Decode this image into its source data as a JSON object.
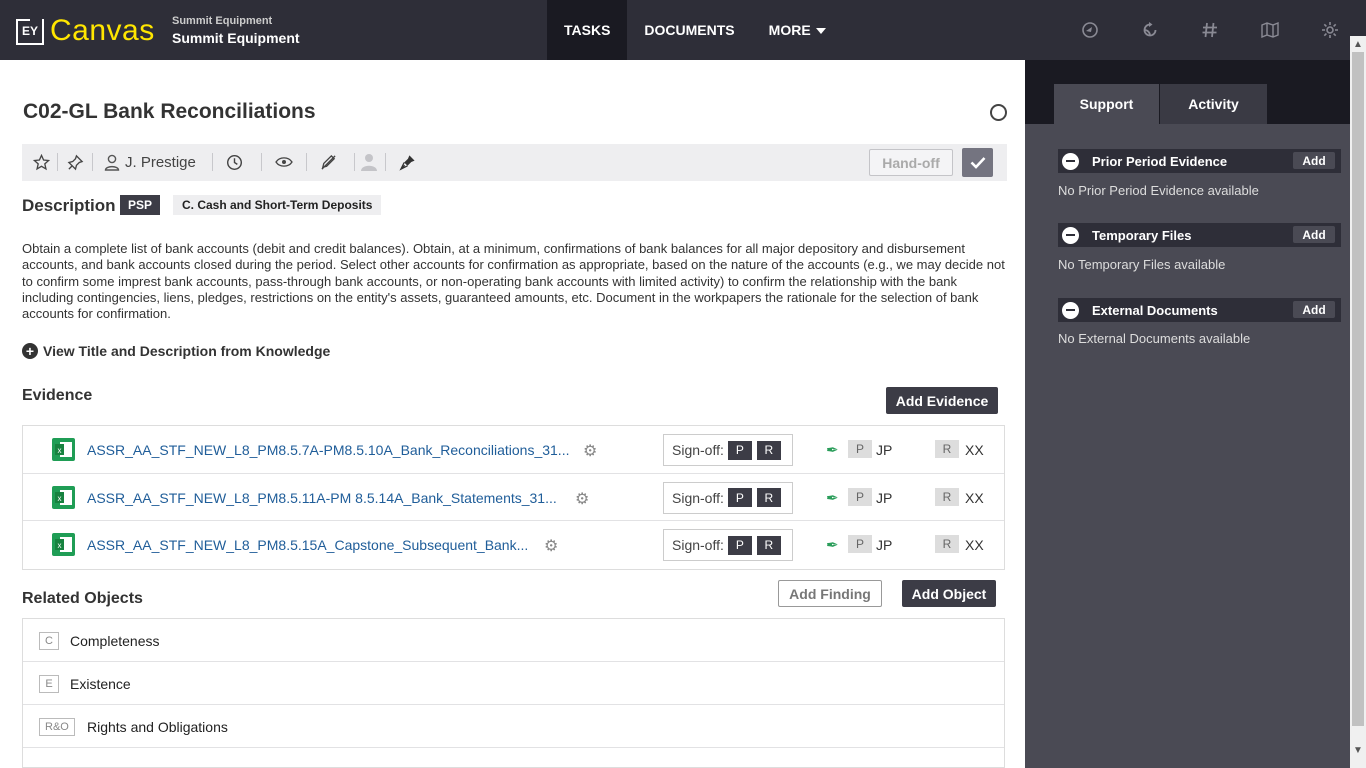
{
  "header": {
    "logo_mark": "EY",
    "app_name": "Canvas",
    "client_small": "Summit Equipment",
    "client_large": "Summit Equipment",
    "nav": [
      {
        "label": "TASKS"
      },
      {
        "label": "DOCUMENTS"
      },
      {
        "label": "MORE"
      }
    ],
    "icons": [
      "dashboard-icon",
      "refresh-icon",
      "hashtag-icon",
      "map-icon",
      "settings-icon"
    ]
  },
  "task": {
    "title": "C02-GL Bank Reconciliations",
    "assignee": "J. Prestige",
    "handoff_label": "Hand-off",
    "description_label": "Description",
    "psp_badge": "PSP",
    "category_badge": "C. Cash and Short-Term Deposits",
    "description": "Obtain a complete list of bank accounts (debit and credit balances). Obtain, at a minimum, confirmations of bank balances for all major depository and disbursement accounts, and bank accounts closed during the period. Select other accounts for confirmation as appropriate, based on the nature of the accounts (e.g., we may decide not to confirm some imprest bank accounts, pass-through bank accounts, or non-operating bank accounts with limited activity) to confirm the relationship with the bank including contingencies, liens, pledges, restrictions on the entity's assets, guaranteed amounts, etc. Document in the workpapers the rationale for the selection of bank accounts for confirmation.",
    "view_knowledge": "View Title and Description from Knowledge"
  },
  "evidence": {
    "title": "Evidence",
    "add_label": "Add Evidence",
    "signoff_label": "Sign-off:",
    "items": [
      {
        "name": "ASSR_AA_STF_NEW_L8_PM8.5.7A-PM8.5.10A_Bank_Reconciliations_31...",
        "p": "P",
        "r": "R",
        "preparer": "JP",
        "reviewer": "XX"
      },
      {
        "name": "ASSR_AA_STF_NEW_L8_PM8.5.11A-PM 8.5.14A_Bank_Statements_31...",
        "p": "P",
        "r": "R",
        "preparer": "JP",
        "reviewer": "XX"
      },
      {
        "name": "ASSR_AA_STF_NEW_L8_PM8.5.15A_Capstone_Subsequent_Bank...",
        "p": "P",
        "r": "R",
        "preparer": "JP",
        "reviewer": "XX"
      }
    ]
  },
  "related": {
    "title": "Related Objects",
    "add_finding_label": "Add Finding",
    "add_object_label": "Add Object",
    "items": [
      {
        "code": "C",
        "label": "Completeness"
      },
      {
        "code": "E",
        "label": "Existence"
      },
      {
        "code": "R&O",
        "label": "Rights and Obligations"
      }
    ]
  },
  "support_panel": {
    "tabs": [
      {
        "label": "Support"
      },
      {
        "label": "Activity"
      }
    ],
    "add_label": "Add",
    "sections": [
      {
        "title": "Prior Period Evidence",
        "empty": "No Prior Period Evidence available"
      },
      {
        "title": "Temporary Files",
        "empty": "No Temporary Files available"
      },
      {
        "title": "External Documents",
        "empty": "No External Documents available"
      }
    ]
  }
}
